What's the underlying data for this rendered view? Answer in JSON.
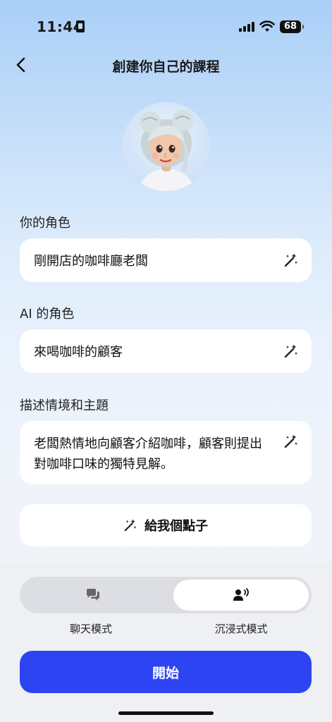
{
  "status_bar": {
    "time": "11:44",
    "battery": "68"
  },
  "header": {
    "title": "創建你自己的課程"
  },
  "form": {
    "your_role_label": "你的角色",
    "your_role_value": "剛開店的咖啡廳老闆",
    "ai_role_label": "AI 的角色",
    "ai_role_value": "來喝咖啡的顧客",
    "scenario_label": "描述情境和主題",
    "scenario_value": "老闆熱情地向顧客介紹咖啡，顧客則提出對咖啡口味的獨特見解。"
  },
  "idea_button": {
    "label": "給我個點子"
  },
  "modes": {
    "chat_label": "聊天模式",
    "immersive_label": "沉浸式模式",
    "selected": "immersive"
  },
  "start_button": {
    "label": "開始"
  },
  "colors": {
    "accent": "#2d44f2",
    "toggle_selected": "#ffffff",
    "toggle_track": "#dcdee3"
  }
}
